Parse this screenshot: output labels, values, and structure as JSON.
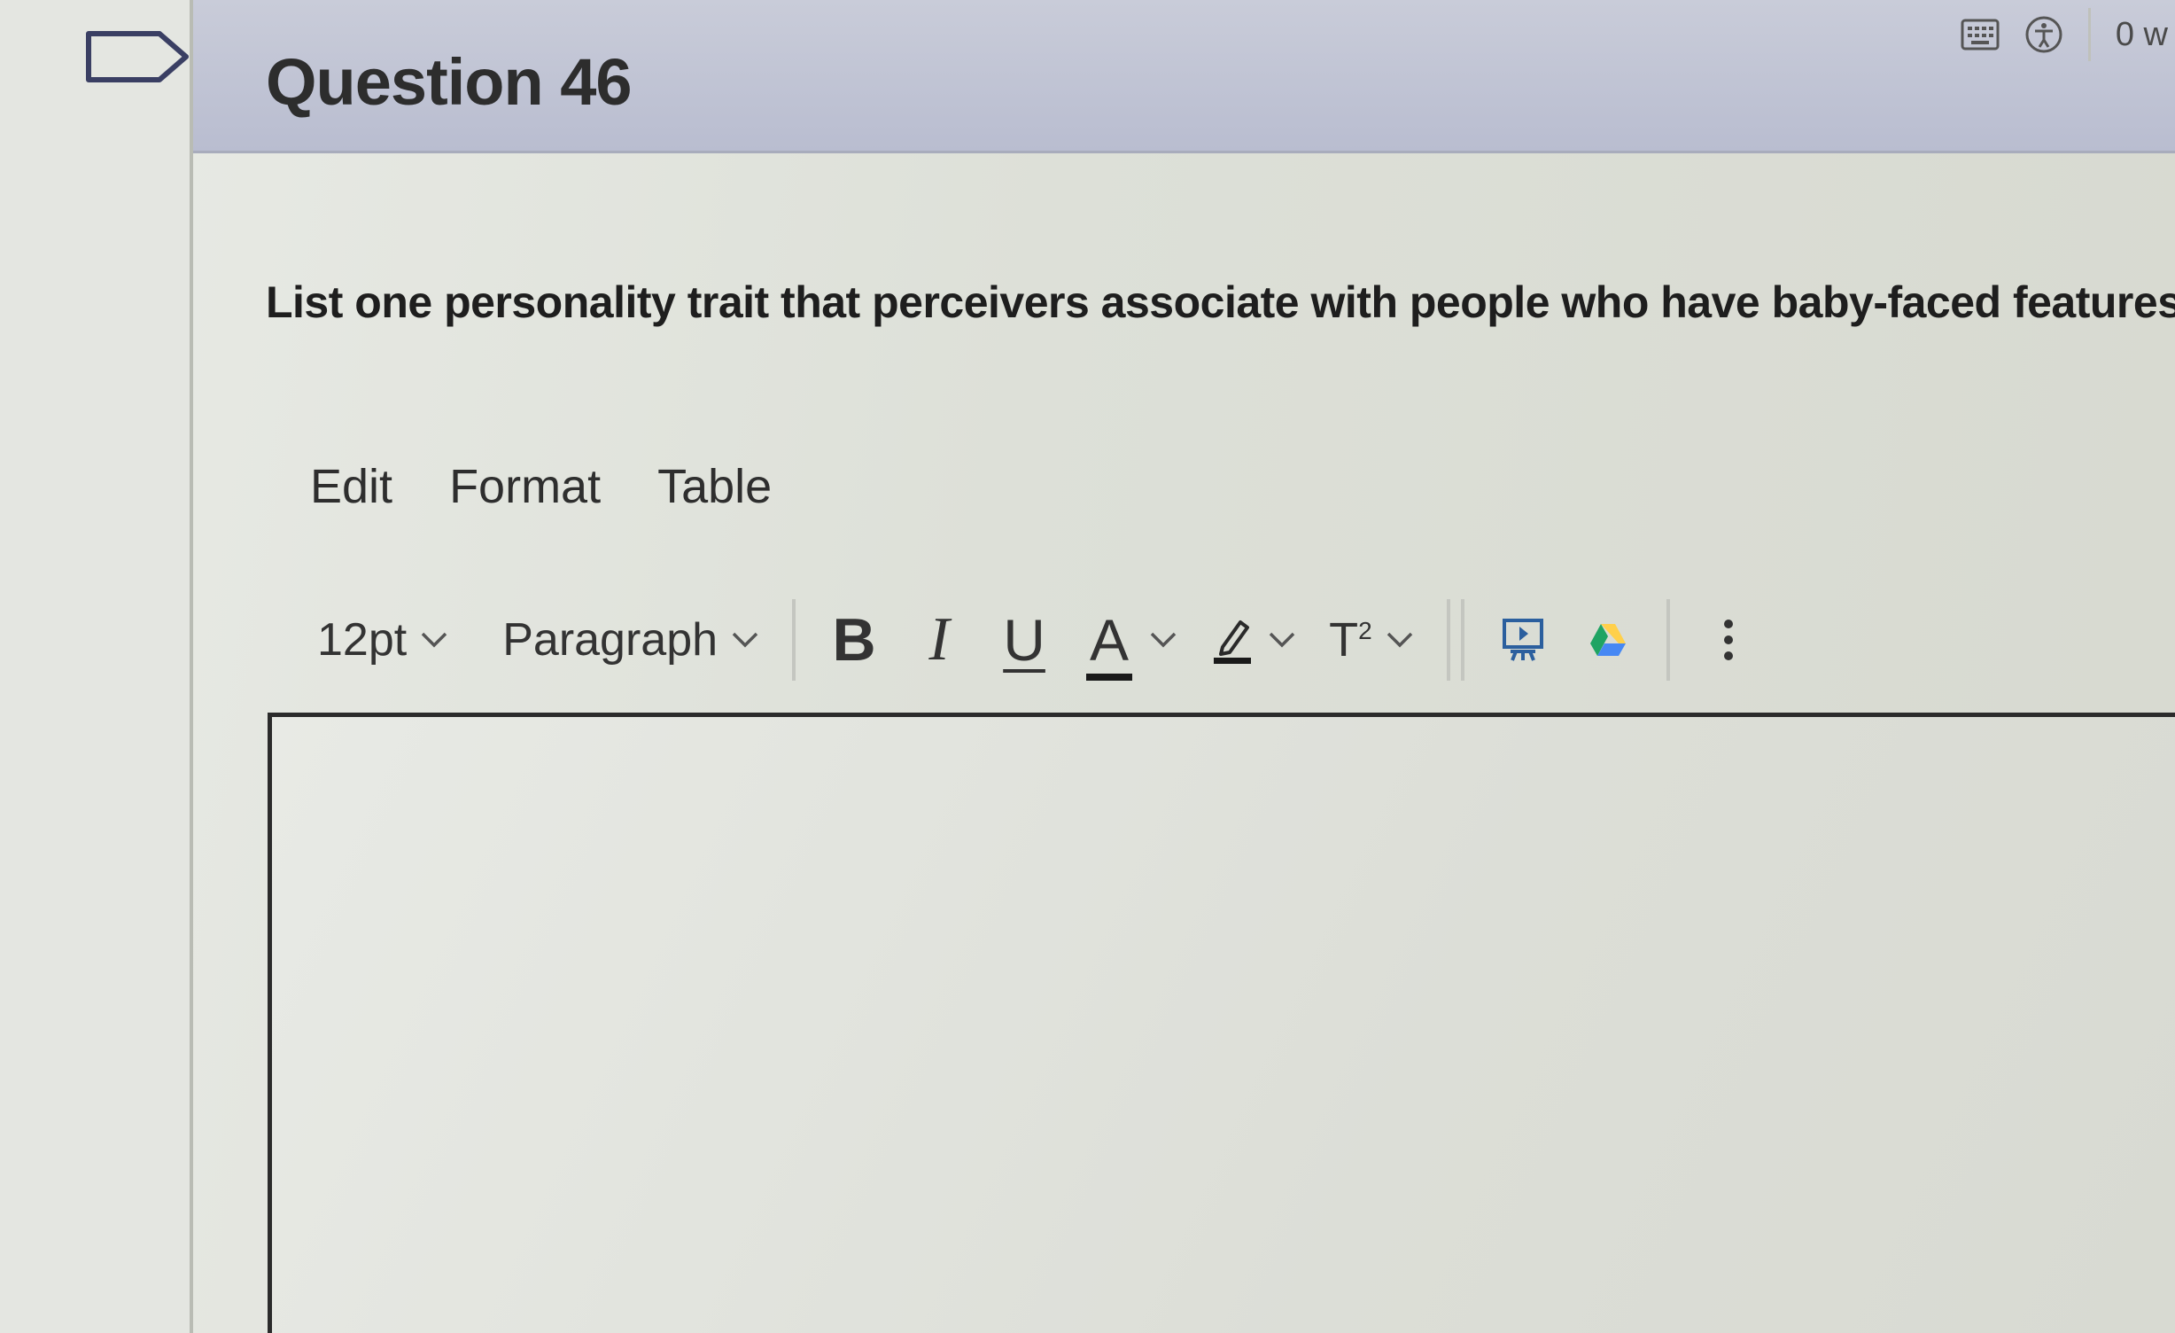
{
  "header": {
    "title": "Question 46",
    "right_label": "0 w"
  },
  "question": {
    "text": "List one personality trait that perceivers associate with people who have baby-faced features"
  },
  "editor_menu": {
    "items": [
      {
        "label": "Edit"
      },
      {
        "label": "Format"
      },
      {
        "label": "Table"
      }
    ]
  },
  "toolbar": {
    "font_size": "12pt",
    "block_format": "Paragraph",
    "bold_label": "B",
    "italic_label": "I",
    "underline_label": "U",
    "text_color_label": "A",
    "superscript_label": "T",
    "superscript_exp": "2"
  },
  "editor": {
    "content": ""
  },
  "icons": {
    "flag": "flag-icon",
    "keyboard": "keyboard-icon",
    "accessibility": "accessibility-icon",
    "highlight": "highlight-pen-icon",
    "media": "media-icon",
    "drive": "google-drive-icon",
    "more": "more-vertical-icon"
  },
  "colors": {
    "header_band": "#b9bdd0",
    "text": "#1e1e1e",
    "editor_border": "#2b2b2b",
    "drive_green": "#1fa463",
    "drive_yellow": "#ffd04b",
    "drive_blue": "#4688f4",
    "media_blue": "#2b5f9e"
  }
}
